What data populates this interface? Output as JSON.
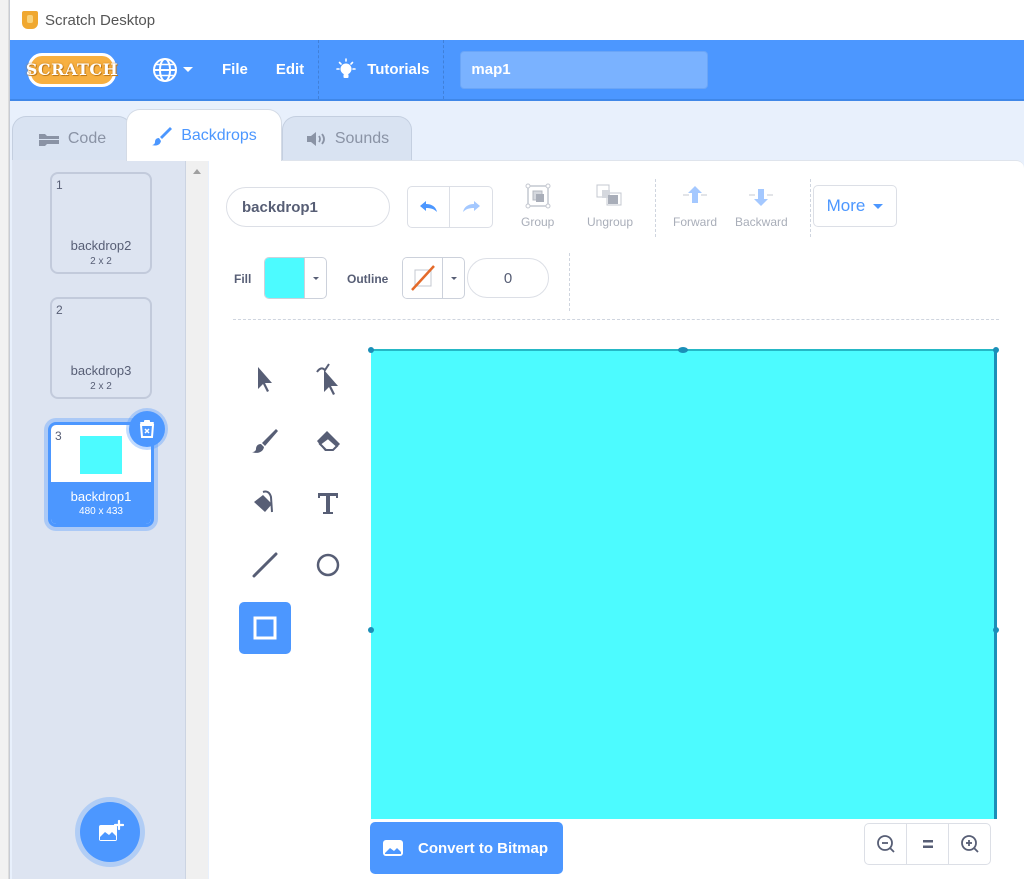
{
  "window": {
    "title": "Scratch Desktop"
  },
  "menubar": {
    "logo_text": "SCRATCH",
    "file_label": "File",
    "edit_label": "Edit",
    "tutorials_label": "Tutorials",
    "project_title": "map1"
  },
  "tabs": [
    {
      "label": "Code",
      "icon": "code-blocks-icon",
      "active": false
    },
    {
      "label": "Backdrops",
      "icon": "paintbrush-icon",
      "active": true
    },
    {
      "label": "Sounds",
      "icon": "speaker-icon",
      "active": false
    }
  ],
  "backdrops": [
    {
      "number": "1",
      "name": "backdrop2",
      "size": "2 x 2",
      "selected": false
    },
    {
      "number": "2",
      "name": "backdrop3",
      "size": "2 x 2",
      "selected": false
    },
    {
      "number": "3",
      "name": "backdrop1",
      "size": "480 x 433",
      "selected": true,
      "thumb_color": "#4cfbff"
    }
  ],
  "editor": {
    "costume_name": "backdrop1",
    "group_label": "Group",
    "ungroup_label": "Ungroup",
    "forward_label": "Forward",
    "backward_label": "Backward",
    "more_label": "More",
    "fill_label": "Fill",
    "fill_color": "#4cfbff",
    "outline_label": "Outline",
    "outline_width": "0",
    "convert_label": "Convert to Bitmap",
    "active_tool": "rectangle",
    "canvas_fill": "#4cfbff"
  },
  "colors": {
    "accent": "#4c97ff",
    "menubar": "#4c97ff"
  }
}
